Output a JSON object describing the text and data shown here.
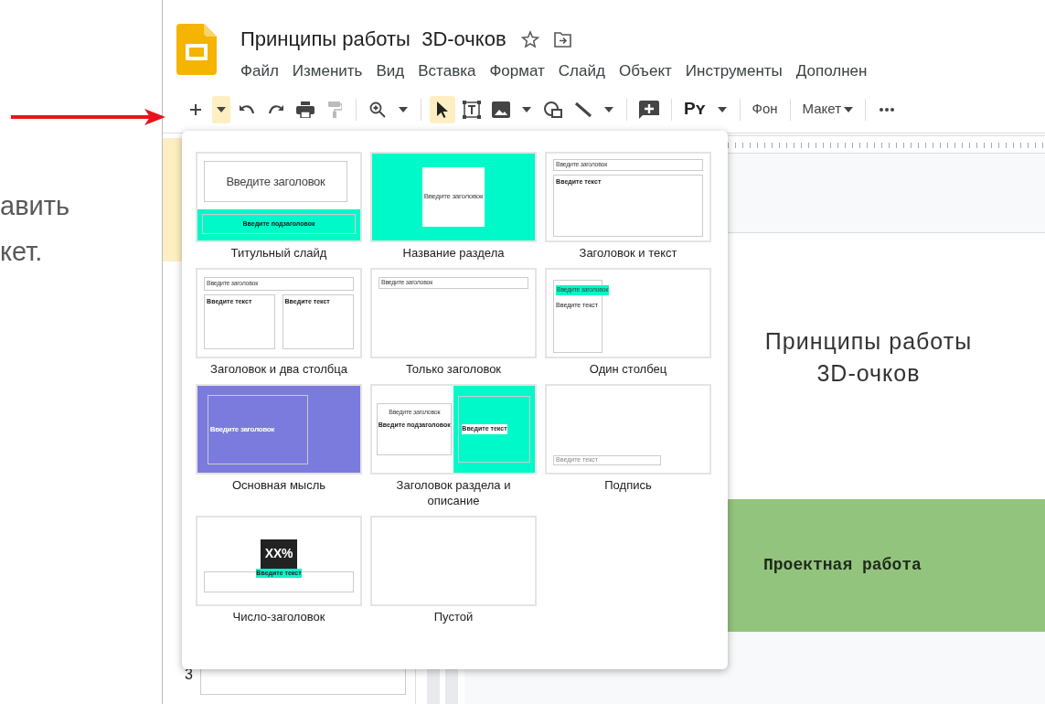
{
  "caption_lines": [
    "авить",
    "кет."
  ],
  "document": {
    "title": "Принципы работы  3D-очков"
  },
  "menu": [
    "Файл",
    "Изменить",
    "Вид",
    "Вставка",
    "Формат",
    "Слайд",
    "Объект",
    "Инструменты",
    "Дополнен"
  ],
  "toolbar": [
    {
      "kind": "plus",
      "active": false
    },
    {
      "kind": "caret",
      "active": true
    },
    {
      "kind": "undo",
      "active": false
    },
    {
      "kind": "redo",
      "active": false
    },
    {
      "kind": "print",
      "active": false
    },
    {
      "kind": "paint",
      "active": false,
      "disabled": true
    },
    {
      "kind": "separator"
    },
    {
      "kind": "zoom",
      "active": false
    },
    {
      "kind": "caret",
      "active": false
    },
    {
      "kind": "separator"
    },
    {
      "kind": "select",
      "active": true
    },
    {
      "kind": "textbox",
      "active": false
    },
    {
      "kind": "image",
      "active": false
    },
    {
      "kind": "caret",
      "active": false
    },
    {
      "kind": "shape",
      "active": false
    },
    {
      "kind": "line",
      "active": false
    },
    {
      "kind": "caret",
      "active": false
    },
    {
      "kind": "separator"
    },
    {
      "kind": "comment",
      "active": false
    },
    {
      "kind": "separator"
    },
    {
      "kind": "text",
      "label": "Pʏ",
      "active": false
    },
    {
      "kind": "caret",
      "active": false
    },
    {
      "kind": "separator"
    },
    {
      "kind": "text",
      "label": "Фон",
      "active": false
    },
    {
      "kind": "separator"
    },
    {
      "kind": "text",
      "label": "Макет",
      "caret": true,
      "active": false
    },
    {
      "kind": "separator"
    },
    {
      "kind": "more",
      "active": false
    }
  ],
  "layouts": [
    {
      "kind": "title",
      "label": "Титульный слайд",
      "heading": "Введите заголовок",
      "subheading": "Введите подзаголовок"
    },
    {
      "kind": "section",
      "label": "Название раздела",
      "heading": "Введите заголовок"
    },
    {
      "kind": "title_body",
      "label": "Заголовок и текст",
      "heading": "Введите заголовок",
      "body": "Введите текст"
    },
    {
      "kind": "two_columns",
      "label": "Заголовок и два столбца",
      "heading": "Введите заголовок",
      "body": "Введите текст",
      "body_2": "Введите текст"
    },
    {
      "kind": "title_only",
      "label": "Только заголовок",
      "heading": "Введите заголовок"
    },
    {
      "kind": "one_column",
      "label": "Один столбец",
      "heading": "Введите заголовок",
      "body": "Введите текст"
    },
    {
      "kind": "main_point",
      "label": "Основная мысль",
      "heading": "Введите заголовок"
    },
    {
      "kind": "section_description",
      "label": "Заголовок раздела и описание",
      "heading": "Введите заголовок",
      "subheading": "Введите подзаголовок",
      "body": "Введите текст"
    },
    {
      "kind": "caption",
      "label": "Подпись",
      "body": "Введите текст"
    },
    {
      "kind": "big_number",
      "label": "Число-заголовок",
      "number": "XX%",
      "body": "Введите текст"
    },
    {
      "kind": "blank",
      "label": "Пустой"
    }
  ],
  "filmstrip": [
    {
      "selected": true
    },
    {
      "number": "3",
      "selected": false
    }
  ],
  "slide": {
    "title": "Принципы работы\n3D-очков",
    "band_text": "Проектная работа"
  }
}
